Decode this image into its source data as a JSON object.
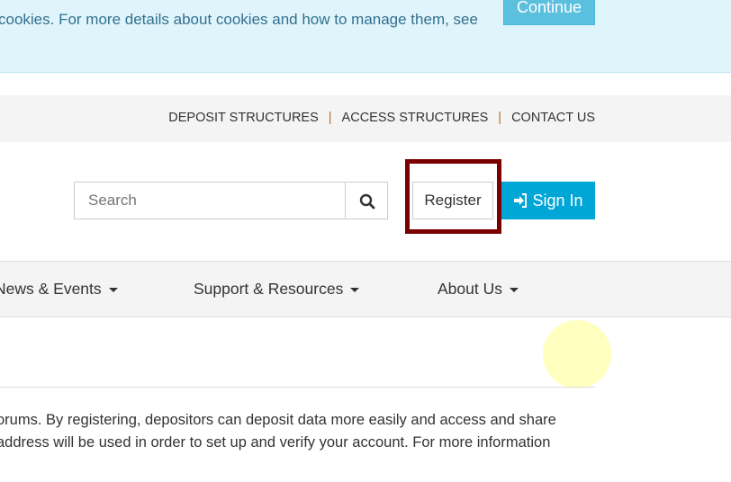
{
  "cookie_banner": {
    "text": "cookies. For more details about cookies and how to manage them, see",
    "continue_label": "Continue"
  },
  "top_links": [
    "DEPOSIT STRUCTURES",
    "ACCESS STRUCTURES",
    "CONTACT US"
  ],
  "top_links_separator": "|",
  "header": {
    "search_placeholder": "Search",
    "register_label": "Register",
    "signin_label": "Sign In"
  },
  "nav": [
    {
      "label": "News & Events"
    },
    {
      "label": "Support & Resources"
    },
    {
      "label": "About Us"
    }
  ],
  "content": {
    "lines": [
      "orums. By registering, depositors can deposit data more easily and access and share",
      "address will be used in order to set up and verify your account. For more information"
    ]
  },
  "colors": {
    "banner_bg": "#e0f5fb",
    "continue_bg": "#5bc0de",
    "signin_bg": "#00a6d6",
    "highlight_border": "#7a0000",
    "cursor_highlight": "#ffffc0"
  }
}
